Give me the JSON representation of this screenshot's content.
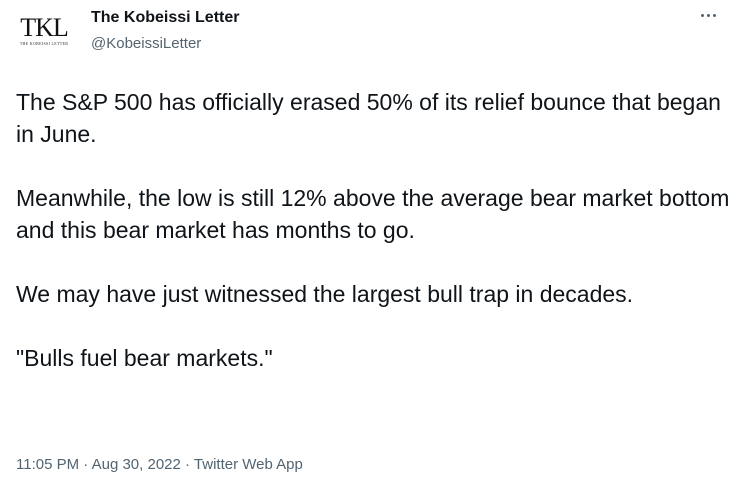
{
  "author": {
    "avatar_mark": "TKL",
    "avatar_sub": "THE KOBEISSI LETTER",
    "name": "The Kobeissi Letter",
    "handle": "@KobeissiLetter"
  },
  "more_icon": "more-horizontal-icon",
  "tweet": {
    "paragraphs": [
      "The S&P 500 has officially erased 50% of its relief bounce that began in June.",
      "Meanwhile, the low is still 12% above the average bear market bottom and this bear market has months to go.",
      "We may have just witnessed the largest bull trap in decades.",
      "\"Bulls fuel bear markets.\""
    ]
  },
  "meta": {
    "time": "11:05 PM",
    "sep1": " · ",
    "date": "Aug 30, 2022",
    "sep2": " · ",
    "source": "Twitter Web App"
  },
  "colors": {
    "text": "#0f1419",
    "secondary": "#536471",
    "background": "#ffffff"
  }
}
